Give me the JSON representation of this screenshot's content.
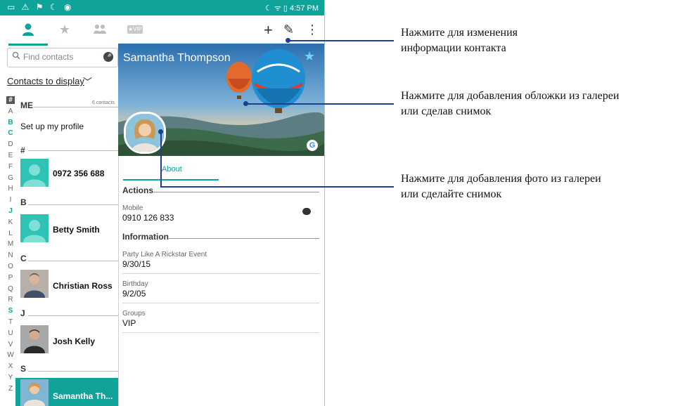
{
  "status_bar": {
    "left_icons": "▭ ⚠ ⚑ ☾ ◉",
    "right_text": "☾ ᯤ ▯ 4:57 PM"
  },
  "toolbar": {
    "vip_label": "★VIP",
    "add_label": "+",
    "edit_label": "✎",
    "more_label": "⋮"
  },
  "search": {
    "placeholder": "Find contacts"
  },
  "contacts_to_display": "Contacts to display",
  "alphabet": [
    "#",
    "A",
    "B",
    "C",
    "D",
    "E",
    "F",
    "G",
    "H",
    "I",
    "J",
    "K",
    "L",
    "M",
    "N",
    "O",
    "P",
    "Q",
    "R",
    "S",
    "T",
    "U",
    "V",
    "W",
    "X",
    "Y",
    "Z"
  ],
  "alphabet_active": [
    "#",
    "B",
    "C",
    "J",
    "S"
  ],
  "list": {
    "me_header": "ME",
    "me_count": "6 contacts",
    "setup_profile": "Set up my profile",
    "section_hash": "#",
    "contact_0972": "0972 356 688",
    "section_b": "B",
    "contact_betty": "Betty Smith",
    "section_c": "C",
    "contact_christian": "Christian Ross",
    "section_j": "J",
    "contact_josh": "Josh Kelly",
    "section_s": "S",
    "contact_samantha": "Samantha Th..."
  },
  "detail": {
    "name": "Samantha Thompson",
    "about_tab": "About",
    "actions_title": "Actions",
    "mobile_label": "Mobile",
    "mobile_value": "0910 126 833",
    "information_title": "Information",
    "event_label": "Party Like A Rickstar Event",
    "event_value": "9/30/15",
    "birthday_label": "Birthday",
    "birthday_value": "9/2/05",
    "groups_label": "Groups",
    "groups_value": "VIP",
    "google_badge": "G"
  },
  "callouts": {
    "edit_line1": "Нажмите для изменения",
    "edit_line2": "информации контакта",
    "cover_line1": "Нажмите для добавления обложки из галереи",
    "cover_line2": "или сделав снимок",
    "photo_line1": "Нажмите для добавления фото из галереи",
    "photo_line2": "или сделайте снимок"
  },
  "colors": {
    "accent": "#0fa39a",
    "callout_line": "#1d3f8c"
  }
}
